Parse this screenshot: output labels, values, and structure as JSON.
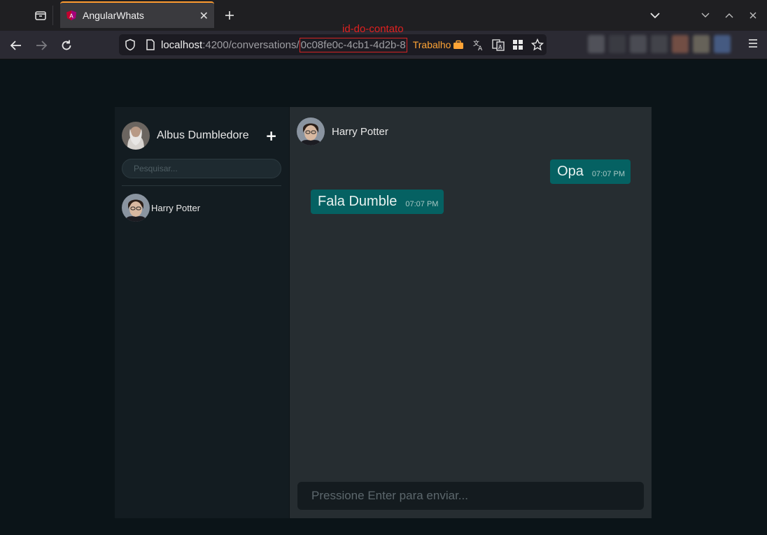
{
  "browser": {
    "tab_title": "AngularWhats",
    "url_host": "localhost",
    "url_path": ":4200/conversations/",
    "url_id": "0c08fe0c-4cb1-4d2b-8",
    "container_label": "Trabalho",
    "annotation": "id-do-contato"
  },
  "app": {
    "user": {
      "name": "Albus Dumbledore",
      "add_label": "+"
    },
    "search": {
      "placeholder": "Pesquisar..."
    },
    "contacts": [
      {
        "name": "Harry Potter"
      }
    ],
    "chat": {
      "contact_name": "Harry Potter",
      "messages": [
        {
          "text": "Opa",
          "time": "07:07 PM",
          "direction": "out"
        },
        {
          "text": "Fala Dumble",
          "time": "07:07 PM",
          "direction": "in"
        }
      ],
      "composer_placeholder": "Pressione Enter para enviar..."
    },
    "colors": {
      "accent_bubble": "#056162",
      "sidebar_bg": "#131c21",
      "chat_bg": "#262d31"
    }
  }
}
